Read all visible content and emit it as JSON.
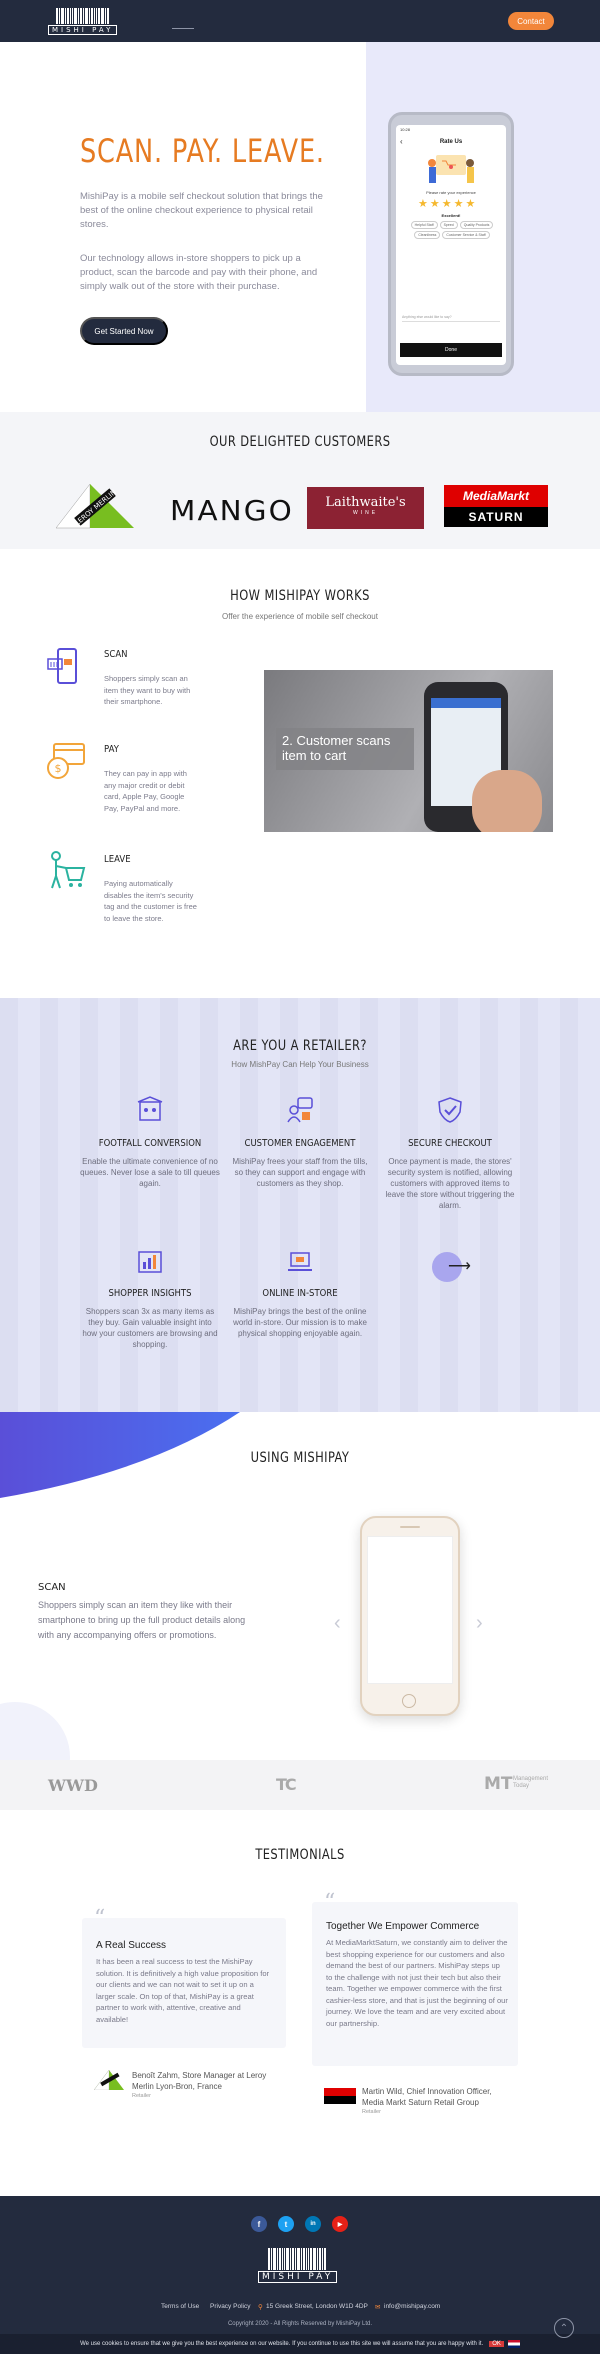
{
  "brand": {
    "logo_text": "MISHI PAY"
  },
  "header": {
    "contact_label": "Contact"
  },
  "hero": {
    "title": "SCAN. PAY. LEAVE.",
    "paragraph1": "MishiPay is a mobile self checkout solution that brings the best of the online checkout experience to physical retail stores.",
    "paragraph2": "Our technology allows in-store shoppers to pick up a product, scan the barcode and pay with their phone, and simply walk out of the store with their purchase.",
    "cta_label": "Get Started Now",
    "phone": {
      "screen_title": "Rate Us",
      "prompt": "Please rate your experience",
      "rating_word": "Excellent!",
      "chips": [
        "Helpful Staff",
        "Speed",
        "Quality Products",
        "Cleanliness",
        "Customer Service & Staff"
      ],
      "comment_placeholder": "Anything else would like to say?",
      "done_label": "Done",
      "status_time": "10:28"
    }
  },
  "customers": {
    "title": "OUR DELIGHTED CUSTOMERS",
    "logos": [
      {
        "name": "leroy-merlin",
        "text": "LEROY MERLIN"
      },
      {
        "name": "mango",
        "text": "MANGO"
      },
      {
        "name": "laithwaites",
        "text": "Laithwaite's",
        "sub": "WINE"
      },
      {
        "name": "mediamarkt-saturn",
        "text": "MediaMarkt",
        "sub": "SATURN"
      }
    ]
  },
  "how": {
    "title": "HOW MISHIPAY WORKS",
    "subtitle": "Offer the experience of mobile self checkout",
    "steps": [
      {
        "title": "SCAN",
        "text": "Shoppers simply scan an item they want to buy with their smartphone."
      },
      {
        "title": "PAY",
        "text": "They can pay in app with any major credit or debit card, Apple Pay, Google Pay, PayPal and more."
      },
      {
        "title": "LEAVE",
        "text": "Paying automatically disables the item's security tag and the customer is free to leave the store."
      }
    ],
    "video_caption": "2. Customer scans item to cart"
  },
  "retailer": {
    "title": "ARE YOU A RETAILER?",
    "subtitle": "How MishPay Can Help Your Business",
    "features": [
      {
        "title": "FOOTFALL CONVERSION",
        "text": "Enable the ultimate convenience of no queues. Never lose a sale to till queues again."
      },
      {
        "title": "CUSTOMER ENGAGEMENT",
        "text": "MishiPay frees your staff from the tills, so they can support and engage with customers as they shop."
      },
      {
        "title": "SECURE CHECKOUT",
        "text": "Once payment is made, the stores' security system is notified, allowing customers with approved items to leave the store without triggering the alarm."
      },
      {
        "title": "SHOPPER INSIGHTS",
        "text": "Shoppers scan 3x as many items as they buy. Gain valuable insight into how your customers are browsing and shopping."
      },
      {
        "title": "ONLINE IN-STORE",
        "text": "MishiPay brings the best of the online world in-store. Our mission is to make physical shopping enjoyable again."
      }
    ]
  },
  "using": {
    "title": "USING MISHIPAY",
    "slide_title": "SCAN",
    "slide_text": "Shoppers simply scan an item they like with their smartphone to bring up the full product details along with any accompanying offers or promotions."
  },
  "press": {
    "logos": [
      "WWD",
      "TC",
      "MT",
      "Management Today"
    ]
  },
  "testimonials": {
    "title": "TESTIMONIALS",
    "items": [
      {
        "heading": "A Real Success",
        "text": "It has been a real success to test the MishiPay solution. It is definitively a high value proposition for our clients and we can not wait to set it up on a larger scale. On top of that, MishiPay is a great partner to work with, attentive, creative and available!",
        "author": "Benoît Zahm, Store Manager at Leroy Merlin Lyon-Bron, France",
        "role": "Retailer"
      },
      {
        "heading": "Together We Empower Commerce",
        "text": "At MediaMarktSaturn, we constantly aim to deliver the best shopping experience for our customers and also demand the best of our partners. MishiPay steps up to the challenge with not just their tech but also their team. Together we empower commerce with the first cashier-less store, and that is just the beginning of our journey. We love the team and are very excited about our partnership.",
        "author": "Martin Wild, Chief Innovation Officer, Media Markt Saturn Retail Group",
        "role": "Retailer"
      }
    ]
  },
  "footer": {
    "social": [
      "f",
      "t",
      "in",
      "yt"
    ],
    "links": [
      "Terms of Use",
      "Privacy Policy"
    ],
    "address": "15 Greek Street, London W1D 4DP",
    "email": "info@mishipay.com",
    "copyright": "Copyright 2020 - All Rights Reserved by MishiPay Ltd.",
    "cookie_text": "We use cookies to ensure that we give you the best experience on our website. If you continue to use this site we will assume that you are happy with it.",
    "cookie_ok": "OK"
  },
  "colors": {
    "navy": "#232b3e",
    "orange": "#f2863a",
    "lavender": "#e8e9fa",
    "purple": "#5a4fd8"
  }
}
